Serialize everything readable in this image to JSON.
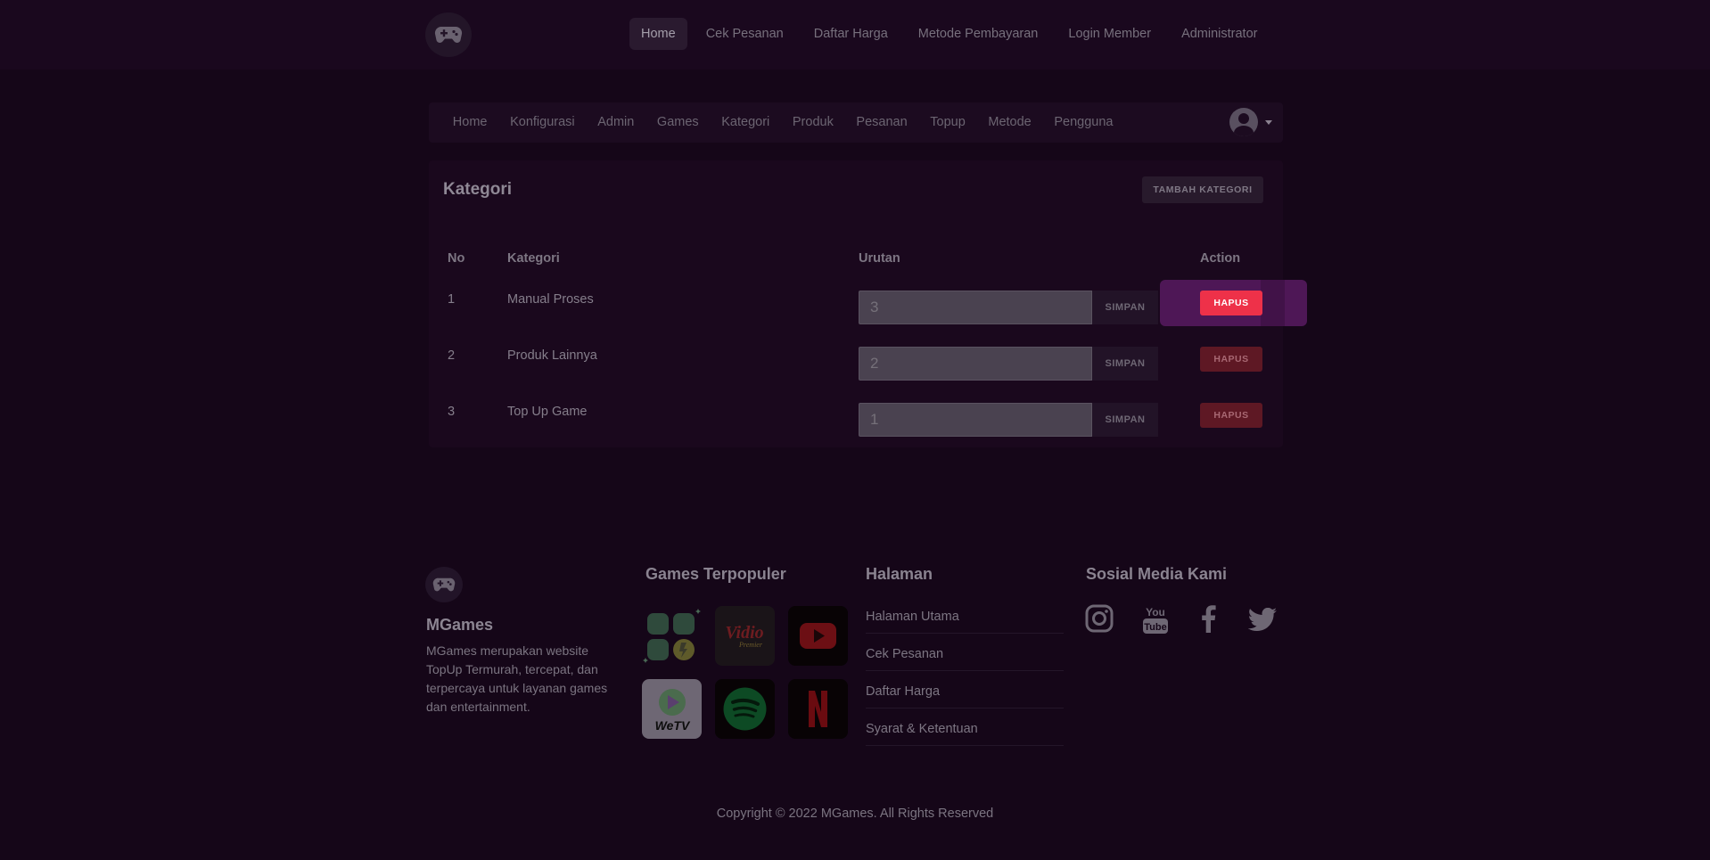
{
  "topnav": {
    "links": [
      "Home",
      "Cek Pesanan",
      "Daftar Harga",
      "Metode Pembayaran",
      "Login Member",
      "Administrator"
    ],
    "active": "Home"
  },
  "adminnav": {
    "links": [
      "Home",
      "Konfigurasi",
      "Admin",
      "Games",
      "Kategori",
      "Produk",
      "Pesanan",
      "Topup",
      "Metode",
      "Pengguna"
    ]
  },
  "card": {
    "title": "Kategori",
    "add_label": "TAMBAH KATEGORI",
    "headers": {
      "no": "No",
      "kategori": "Kategori",
      "urutan": "Urutan",
      "action": "Action"
    },
    "save_label": "SIMPAN",
    "delete_label": "HAPUS",
    "rows": [
      {
        "no": "1",
        "kategori": "Manual Proses",
        "urutan": "3"
      },
      {
        "no": "2",
        "kategori": "Produk Lainnya",
        "urutan": "2"
      },
      {
        "no": "3",
        "kategori": "Top Up Game",
        "urutan": "1"
      }
    ]
  },
  "footer": {
    "brand": "MGames",
    "description": "MGames merupakan website TopUp Termurah, tercepat, dan terpercaya untuk layanan games dan entertainment.",
    "games_heading": "Games Terpopuler",
    "games": [
      "Vidio Premier",
      "YouTube",
      "WeTV",
      "Spotify",
      "Netflix"
    ],
    "pages_heading": "Halaman",
    "pages": [
      "Halaman Utama",
      "Cek Pesanan",
      "Daftar Harga",
      "Syarat & Ketentuan"
    ],
    "social_heading": "Sosial Media Kami",
    "social_icons": [
      "instagram-icon",
      "youtube-icon",
      "facebook-icon",
      "twitter-icon"
    ],
    "copyright": "Copyright © 2022 MGames. All Rights Reserved"
  },
  "colors": {
    "background": "#150618",
    "highlight_row": "#4e1756",
    "hapus_active": "#ee3149"
  }
}
